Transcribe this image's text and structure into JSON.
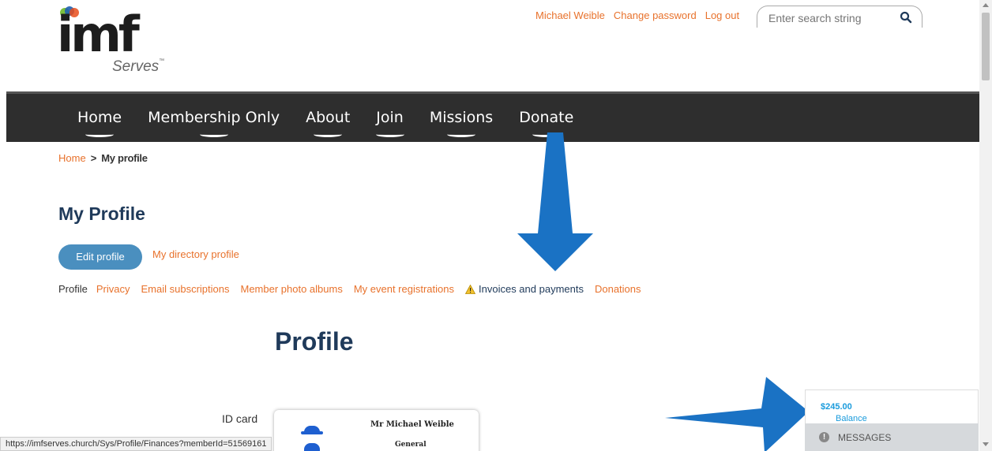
{
  "logo": {
    "wordmark": "imf",
    "tagline": "Serves",
    "tm": "™"
  },
  "header": {
    "user_name": "Michael Weible",
    "change_password": "Change password",
    "logout": "Log out",
    "search_placeholder": "Enter search string"
  },
  "nav": {
    "items": [
      {
        "label": "Home"
      },
      {
        "label": "Membership Only"
      },
      {
        "label": "About"
      },
      {
        "label": "Join"
      },
      {
        "label": "Missions"
      },
      {
        "label": "Donate"
      }
    ]
  },
  "breadcrumb": {
    "home": "Home",
    "separator": ">",
    "current": "My profile"
  },
  "page_title": "My Profile",
  "actions": {
    "edit_profile": "Edit profile",
    "directory_profile": "My directory profile"
  },
  "tabs": {
    "profile": "Profile",
    "privacy": "Privacy",
    "email_subscriptions": "Email subscriptions",
    "photo_albums": "Member photo albums",
    "event_registrations": "My event registrations",
    "invoices": "Invoices and payments",
    "donations": "Donations"
  },
  "section_title": "Profile",
  "id_card": {
    "label": "ID card",
    "name": "Mr Michael Weible",
    "level": "General"
  },
  "balance": {
    "label": "Balance due:",
    "amount": "$245.00"
  },
  "messages": {
    "label": "MESSAGES",
    "icon": "!"
  },
  "status_url": "https://imfserves.church/Sys/Profile/Finances?memberId=51569161",
  "colors": {
    "accent_orange": "#e8722c",
    "navy": "#1f3a5a",
    "nav_bg": "#2e2e2e",
    "button_blue": "#4a8fbf",
    "arrow_blue": "#1a72c4",
    "balance_blue": "#1a9bdc"
  }
}
